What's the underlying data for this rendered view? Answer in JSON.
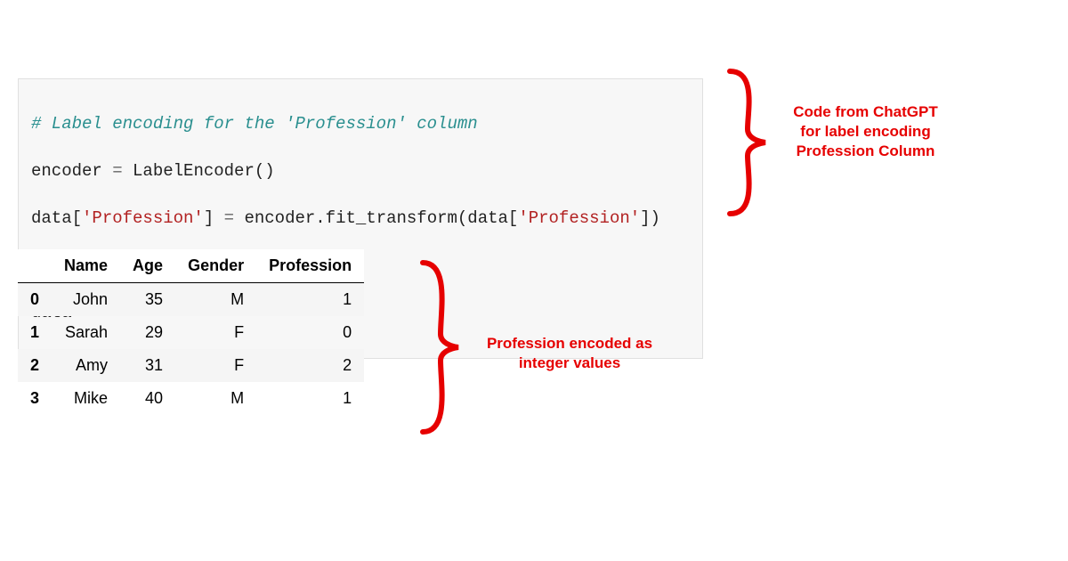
{
  "code": {
    "comment": "# Label encoding for the 'Profession' column",
    "line2_pre": "encoder ",
    "line2_op": "=",
    "line2_post": " LabelEncoder()",
    "line3_a": "data[",
    "line3_s1": "'Profession'",
    "line3_b": "] ",
    "line3_op": "=",
    "line3_c": " encoder.fit_transform(data[",
    "line3_s2": "'Profession'",
    "line3_d": "])",
    "line5": "data"
  },
  "annotations": {
    "code_label": "Code from ChatGPT for label encoding Profession Column",
    "table_label": "Profession encoded as integer values"
  },
  "table": {
    "columns": [
      "Name",
      "Age",
      "Gender",
      "Profession"
    ],
    "rows": [
      {
        "idx": "0",
        "Name": "John",
        "Age": "35",
        "Gender": "M",
        "Profession": "1"
      },
      {
        "idx": "1",
        "Name": "Sarah",
        "Age": "29",
        "Gender": "F",
        "Profession": "0"
      },
      {
        "idx": "2",
        "Name": "Amy",
        "Age": "31",
        "Gender": "F",
        "Profession": "2"
      },
      {
        "idx": "3",
        "Name": "Mike",
        "Age": "40",
        "Gender": "M",
        "Profession": "1"
      }
    ]
  },
  "chart_data": {
    "type": "table",
    "columns": [
      "Name",
      "Age",
      "Gender",
      "Profession"
    ],
    "rows": [
      [
        "John",
        35,
        "M",
        1
      ],
      [
        "Sarah",
        29,
        "F",
        0
      ],
      [
        "Amy",
        31,
        "F",
        2
      ],
      [
        "Mike",
        40,
        "M",
        1
      ]
    ]
  }
}
